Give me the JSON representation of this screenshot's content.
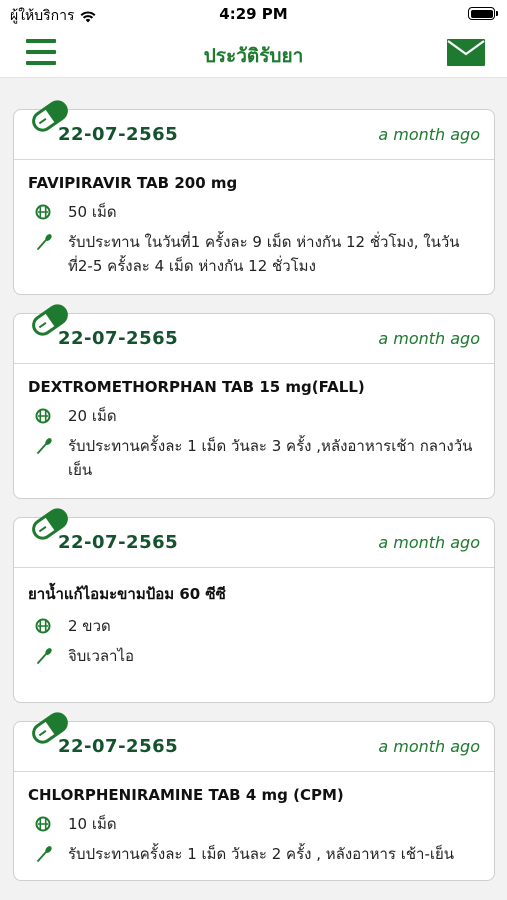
{
  "status_bar": {
    "carrier": "ผู้ให้บริการ",
    "time": "4:29 PM"
  },
  "header": {
    "title": "ประวัติรับยา"
  },
  "records": [
    {
      "date": "22-07-2565",
      "ago": "a month ago",
      "drug": "FAVIPIRAVIR TAB 200 mg",
      "quantity": "50 เม็ด",
      "instructions": "รับประทาน ในวันที่1 ครั้งละ 9 เม็ด ห่างกัน 12 ชั่วโมง, ในวันที่2-5 ครั้งละ 4 เม็ด ห่างกัน 12 ชั่วโมง"
    },
    {
      "date": "22-07-2565",
      "ago": "a month ago",
      "drug": "DEXTROMETHORPHAN TAB 15 mg(FALL)",
      "quantity": "20 เม็ด",
      "instructions": "รับประทานครั้งละ 1 เม็ด วันละ 3 ครั้ง ,หลังอาหารเช้า กลางวัน เย็น"
    },
    {
      "date": "22-07-2565",
      "ago": "a month ago",
      "drug": "ยาน้ำแก้ไอมะขามป้อม  60 ซีซี",
      "quantity": "2 ขวด",
      "instructions": "จิบเวลาไอ"
    },
    {
      "date": "22-07-2565",
      "ago": "a month ago",
      "drug": "CHLORPHENIRAMINE TAB 4 mg (CPM)",
      "quantity": "10 เม็ด",
      "instructions": "รับประทานครั้งละ 1 เม็ด วันละ 2 ครั้ง , หลังอาหาร เช้า-เย็น"
    }
  ],
  "icons": {
    "menu": "hamburger-icon",
    "mail": "envelope-icon",
    "record": "pill-icon",
    "quantity": "tablet-icon",
    "usage": "spoon-icon"
  },
  "colors": {
    "accent": "#1e7a2e",
    "date": "#14532d",
    "background": "#f2f2f2"
  }
}
